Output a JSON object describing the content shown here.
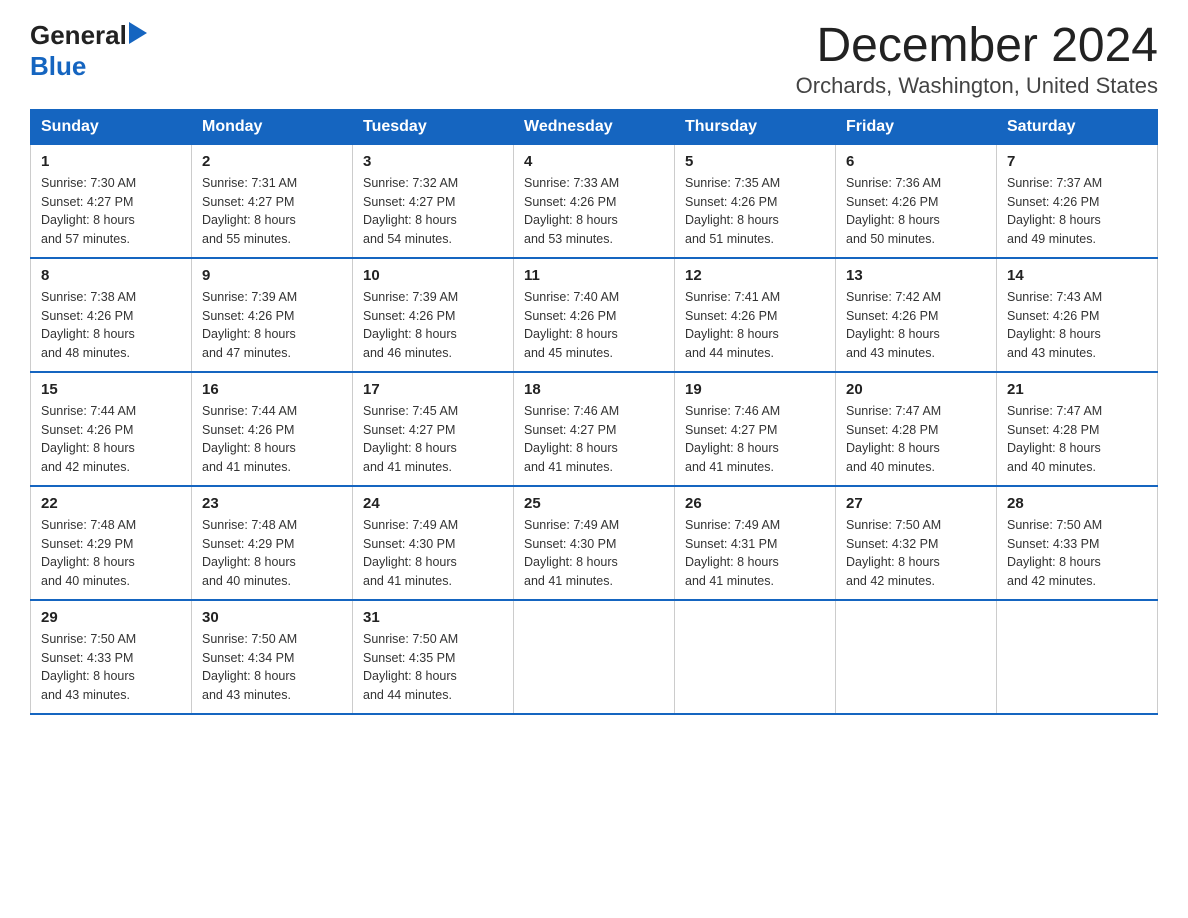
{
  "header": {
    "logo_general": "General",
    "logo_blue": "Blue",
    "title": "December 2024",
    "subtitle": "Orchards, Washington, United States"
  },
  "days_of_week": [
    "Sunday",
    "Monday",
    "Tuesday",
    "Wednesday",
    "Thursday",
    "Friday",
    "Saturday"
  ],
  "weeks": [
    [
      {
        "day": "1",
        "sunrise": "7:30 AM",
        "sunset": "4:27 PM",
        "daylight": "8 hours and 57 minutes."
      },
      {
        "day": "2",
        "sunrise": "7:31 AM",
        "sunset": "4:27 PM",
        "daylight": "8 hours and 55 minutes."
      },
      {
        "day": "3",
        "sunrise": "7:32 AM",
        "sunset": "4:27 PM",
        "daylight": "8 hours and 54 minutes."
      },
      {
        "day": "4",
        "sunrise": "7:33 AM",
        "sunset": "4:26 PM",
        "daylight": "8 hours and 53 minutes."
      },
      {
        "day": "5",
        "sunrise": "7:35 AM",
        "sunset": "4:26 PM",
        "daylight": "8 hours and 51 minutes."
      },
      {
        "day": "6",
        "sunrise": "7:36 AM",
        "sunset": "4:26 PM",
        "daylight": "8 hours and 50 minutes."
      },
      {
        "day": "7",
        "sunrise": "7:37 AM",
        "sunset": "4:26 PM",
        "daylight": "8 hours and 49 minutes."
      }
    ],
    [
      {
        "day": "8",
        "sunrise": "7:38 AM",
        "sunset": "4:26 PM",
        "daylight": "8 hours and 48 minutes."
      },
      {
        "day": "9",
        "sunrise": "7:39 AM",
        "sunset": "4:26 PM",
        "daylight": "8 hours and 47 minutes."
      },
      {
        "day": "10",
        "sunrise": "7:39 AM",
        "sunset": "4:26 PM",
        "daylight": "8 hours and 46 minutes."
      },
      {
        "day": "11",
        "sunrise": "7:40 AM",
        "sunset": "4:26 PM",
        "daylight": "8 hours and 45 minutes."
      },
      {
        "day": "12",
        "sunrise": "7:41 AM",
        "sunset": "4:26 PM",
        "daylight": "8 hours and 44 minutes."
      },
      {
        "day": "13",
        "sunrise": "7:42 AM",
        "sunset": "4:26 PM",
        "daylight": "8 hours and 43 minutes."
      },
      {
        "day": "14",
        "sunrise": "7:43 AM",
        "sunset": "4:26 PM",
        "daylight": "8 hours and 43 minutes."
      }
    ],
    [
      {
        "day": "15",
        "sunrise": "7:44 AM",
        "sunset": "4:26 PM",
        "daylight": "8 hours and 42 minutes."
      },
      {
        "day": "16",
        "sunrise": "7:44 AM",
        "sunset": "4:26 PM",
        "daylight": "8 hours and 41 minutes."
      },
      {
        "day": "17",
        "sunrise": "7:45 AM",
        "sunset": "4:27 PM",
        "daylight": "8 hours and 41 minutes."
      },
      {
        "day": "18",
        "sunrise": "7:46 AM",
        "sunset": "4:27 PM",
        "daylight": "8 hours and 41 minutes."
      },
      {
        "day": "19",
        "sunrise": "7:46 AM",
        "sunset": "4:27 PM",
        "daylight": "8 hours and 41 minutes."
      },
      {
        "day": "20",
        "sunrise": "7:47 AM",
        "sunset": "4:28 PM",
        "daylight": "8 hours and 40 minutes."
      },
      {
        "day": "21",
        "sunrise": "7:47 AM",
        "sunset": "4:28 PM",
        "daylight": "8 hours and 40 minutes."
      }
    ],
    [
      {
        "day": "22",
        "sunrise": "7:48 AM",
        "sunset": "4:29 PM",
        "daylight": "8 hours and 40 minutes."
      },
      {
        "day": "23",
        "sunrise": "7:48 AM",
        "sunset": "4:29 PM",
        "daylight": "8 hours and 40 minutes."
      },
      {
        "day": "24",
        "sunrise": "7:49 AM",
        "sunset": "4:30 PM",
        "daylight": "8 hours and 41 minutes."
      },
      {
        "day": "25",
        "sunrise": "7:49 AM",
        "sunset": "4:30 PM",
        "daylight": "8 hours and 41 minutes."
      },
      {
        "day": "26",
        "sunrise": "7:49 AM",
        "sunset": "4:31 PM",
        "daylight": "8 hours and 41 minutes."
      },
      {
        "day": "27",
        "sunrise": "7:50 AM",
        "sunset": "4:32 PM",
        "daylight": "8 hours and 42 minutes."
      },
      {
        "day": "28",
        "sunrise": "7:50 AM",
        "sunset": "4:33 PM",
        "daylight": "8 hours and 42 minutes."
      }
    ],
    [
      {
        "day": "29",
        "sunrise": "7:50 AM",
        "sunset": "4:33 PM",
        "daylight": "8 hours and 43 minutes."
      },
      {
        "day": "30",
        "sunrise": "7:50 AM",
        "sunset": "4:34 PM",
        "daylight": "8 hours and 43 minutes."
      },
      {
        "day": "31",
        "sunrise": "7:50 AM",
        "sunset": "4:35 PM",
        "daylight": "8 hours and 44 minutes."
      },
      null,
      null,
      null,
      null
    ]
  ],
  "labels": {
    "sunrise": "Sunrise:",
    "sunset": "Sunset:",
    "daylight": "Daylight:"
  }
}
